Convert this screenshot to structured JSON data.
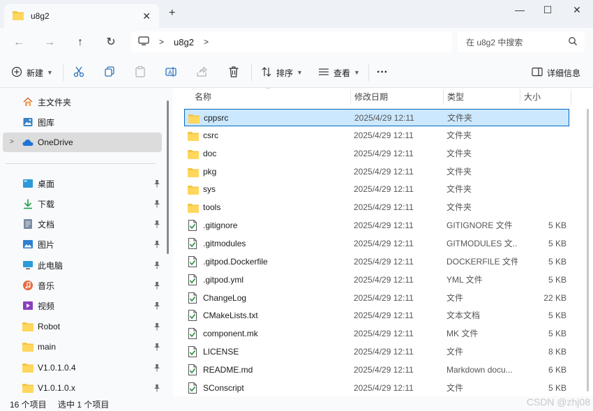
{
  "window": {
    "tab_title": "u8g2",
    "tab_close": "✕",
    "new_tab": "+",
    "minimize": "—",
    "maximize": "☐",
    "close": "✕"
  },
  "nav": {
    "back": "←",
    "forward": "→",
    "up": "↑",
    "refresh": "↻"
  },
  "breadcrumb": {
    "sep1": ">",
    "folder": "u8g2",
    "sep2": ">"
  },
  "search": {
    "placeholder": "在 u8g2 中搜索"
  },
  "toolbar": {
    "new_label": "新建",
    "sort_label": "排序",
    "view_label": "查看",
    "more_label": "···",
    "details_label": "详细信息"
  },
  "sidebar": {
    "top_items": [
      {
        "label": "主文件夹"
      },
      {
        "label": "图库"
      },
      {
        "label": "OneDrive"
      }
    ],
    "pinned_items": [
      {
        "label": "桌面"
      },
      {
        "label": "下载"
      },
      {
        "label": "文档"
      },
      {
        "label": "图片"
      },
      {
        "label": "此电脑"
      },
      {
        "label": "音乐"
      },
      {
        "label": "视频"
      },
      {
        "label": "Robot"
      },
      {
        "label": "main"
      },
      {
        "label": "V1.0.1.0.4"
      },
      {
        "label": "V1.0.1.0.x"
      }
    ]
  },
  "columns": {
    "name": "名称",
    "date": "修改日期",
    "type": "类型",
    "size": "大小",
    "sort_indicator": "^"
  },
  "files": [
    {
      "name": "cppsrc",
      "date": "2025/4/29 12:11",
      "type": "文件夹",
      "size": "",
      "kind": "folder"
    },
    {
      "name": "csrc",
      "date": "2025/4/29 12:11",
      "type": "文件夹",
      "size": "",
      "kind": "folder"
    },
    {
      "name": "doc",
      "date": "2025/4/29 12:11",
      "type": "文件夹",
      "size": "",
      "kind": "folder"
    },
    {
      "name": "pkg",
      "date": "2025/4/29 12:11",
      "type": "文件夹",
      "size": "",
      "kind": "folder"
    },
    {
      "name": "sys",
      "date": "2025/4/29 12:11",
      "type": "文件夹",
      "size": "",
      "kind": "folder"
    },
    {
      "name": "tools",
      "date": "2025/4/29 12:11",
      "type": "文件夹",
      "size": "",
      "kind": "folder"
    },
    {
      "name": ".gitignore",
      "date": "2025/4/29 12:11",
      "type": "GITIGNORE 文件",
      "size": "5 KB",
      "kind": "file"
    },
    {
      "name": ".gitmodules",
      "date": "2025/4/29 12:11",
      "type": "GITMODULES 文...",
      "size": "5 KB",
      "kind": "file"
    },
    {
      "name": ".gitpod.Dockerfile",
      "date": "2025/4/29 12:11",
      "type": "DOCKERFILE 文件",
      "size": "5 KB",
      "kind": "file"
    },
    {
      "name": ".gitpod.yml",
      "date": "2025/4/29 12:11",
      "type": "YML 文件",
      "size": "5 KB",
      "kind": "file"
    },
    {
      "name": "ChangeLog",
      "date": "2025/4/29 12:11",
      "type": "文件",
      "size": "22 KB",
      "kind": "file"
    },
    {
      "name": "CMakeLists.txt",
      "date": "2025/4/29 12:11",
      "type": "文本文档",
      "size": "5 KB",
      "kind": "file"
    },
    {
      "name": "component.mk",
      "date": "2025/4/29 12:11",
      "type": "MK 文件",
      "size": "5 KB",
      "kind": "file"
    },
    {
      "name": "LICENSE",
      "date": "2025/4/29 12:11",
      "type": "文件",
      "size": "8 KB",
      "kind": "file"
    },
    {
      "name": "README.md",
      "date": "2025/4/29 12:11",
      "type": "Markdown docu...",
      "size": "6 KB",
      "kind": "file"
    },
    {
      "name": "SConscript",
      "date": "2025/4/29 12:11",
      "type": "文件",
      "size": "5 KB",
      "kind": "file"
    }
  ],
  "status": {
    "count": "16 个项目",
    "selected": "选中 1 个项目"
  },
  "watermark": "CSDN @zhj08",
  "colors": {
    "folder": "#f4c542",
    "accent": "#0067c0",
    "selected_row": "#cce8ff"
  }
}
